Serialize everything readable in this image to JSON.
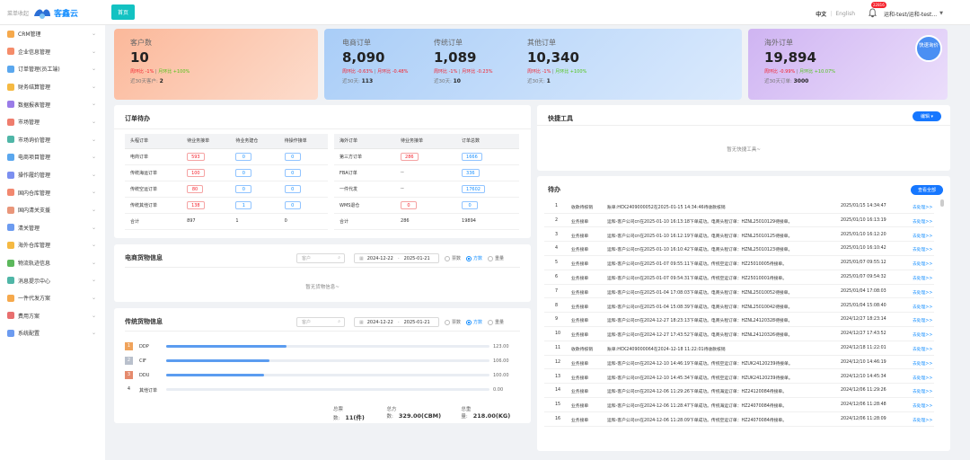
{
  "header": {
    "menu_label": "菜单收起",
    "brand": "客鑫云",
    "home_tab": "首页",
    "lang_zh": "中文",
    "lang_sep": "|",
    "lang_en": "English",
    "badge": "22816",
    "user": "运和-test/运和-test..."
  },
  "sidebar": {
    "items": [
      {
        "label": "CRM管理",
        "color": "#f6a94c"
      },
      {
        "label": "企业信息管理",
        "color": "#f58c6a"
      },
      {
        "label": "订单管理(员工端)",
        "color": "#5aa7ee"
      },
      {
        "label": "财务结算管理",
        "color": "#f5b942"
      },
      {
        "label": "数据报表管理",
        "color": "#9a7ce8"
      },
      {
        "label": "市场管理",
        "color": "#ef7d6d"
      },
      {
        "label": "市场询价管理",
        "color": "#4fb6a7"
      },
      {
        "label": "电商项目管理",
        "color": "#5aa7ee"
      },
      {
        "label": "操作履约管理",
        "color": "#7b8ff0"
      },
      {
        "label": "国内仓库管理",
        "color": "#f2886f"
      },
      {
        "label": "国内清关支援",
        "color": "#e9967a"
      },
      {
        "label": "清关管理",
        "color": "#6c9bf0"
      },
      {
        "label": "海外仓库管理",
        "color": "#f5b942"
      },
      {
        "label": "物流轨迹信息",
        "color": "#5cb85c"
      },
      {
        "label": "消息提示中心",
        "color": "#4fb6a7"
      },
      {
        "label": "一件代发方案",
        "color": "#f6a94c"
      },
      {
        "label": "费用方案",
        "color": "#e86f6f"
      },
      {
        "label": "系统配置",
        "color": "#6c9bf0"
      }
    ]
  },
  "cards": {
    "customers": {
      "title": "客户数",
      "value": "10",
      "cmp_a": "周环比 -1%",
      "cmp_sep": "|",
      "cmp_b": "月环比 +100%",
      "last_label": "近30天客户:",
      "last_value": "2"
    },
    "ecom": {
      "title": "电商订单",
      "value": "8,090",
      "cmp_a": "周环比 -0.63%",
      "cmp_sep": "|",
      "cmp_b": "月环比 -0.48%",
      "last_label": "近30天:",
      "last_value": "113"
    },
    "trad": {
      "title": "传统订单",
      "value": "1,089",
      "cmp_a": "周环比 -1%",
      "cmp_sep": "|",
      "cmp_b": "月环比 -0.23%",
      "last_label": "近30天:",
      "last_value": "10"
    },
    "other": {
      "title": "其他订单",
      "value": "10,340",
      "cmp_a": "周环比 -1%",
      "cmp_sep": "|",
      "cmp_b": "月环比 +100%",
      "last_label": "近30天:",
      "last_value": "1"
    },
    "overseas": {
      "title": "海外订单",
      "value": "19,894",
      "cmp_a": "周环比 -0.99%",
      "cmp_sep": "|",
      "cmp_b": "月环比 +10.07%",
      "last_label": "近30天订单:",
      "last_value": "3000"
    },
    "quick": "快速询价"
  },
  "pending": {
    "title": "订单待办",
    "left_headers": [
      "头程订单",
      "待业务接单",
      "待业务建仓",
      "待操作接单"
    ],
    "left_rows": [
      [
        "电商订单",
        "593",
        "0",
        "0"
      ],
      [
        "传统海运订单",
        "100",
        "0",
        "0"
      ],
      [
        "传统空运订单",
        "80",
        "0",
        "0"
      ],
      [
        "传统其他订单",
        "138",
        "1",
        "0"
      ],
      [
        "合计",
        "897",
        "1",
        "0"
      ]
    ],
    "right_headers": [
      "海外订单",
      "待业务接单",
      "订单总数"
    ],
    "right_rows": [
      [
        "第三方订单",
        "286",
        "1666"
      ],
      [
        "FBA订单",
        "--",
        "336"
      ],
      [
        "一件代发",
        "--",
        "17602"
      ],
      [
        "WMS退仓",
        "0",
        "0"
      ],
      [
        "合计",
        "286",
        "19894"
      ]
    ]
  },
  "ecom_goods": {
    "title": "电商货物信息",
    "customer_ph": "客户",
    "date_from": "2024-12-22",
    "date_to": "2025-01-21",
    "r1": "票数",
    "r2": "方数",
    "r3": "重量",
    "empty": "暂无货物信息~"
  },
  "trad_goods": {
    "title": "传统货物信息",
    "customer_ph": "客户",
    "date_from": "2024-12-22",
    "date_to": "2025-01-21",
    "r1": "票数",
    "r2": "方数",
    "r3": "重量",
    "rows": [
      {
        "rank": "1",
        "name": "DDP",
        "value": "123.00",
        "pct": 0.372
      },
      {
        "rank": "2",
        "name": "CIF",
        "value": "106.00",
        "pct": 0.32
      },
      {
        "rank": "3",
        "name": "DDU",
        "value": "100.00",
        "pct": 0.302
      },
      {
        "rank": "4",
        "name": "其他订单",
        "value": "0.00",
        "pct": 0
      }
    ],
    "totals": [
      {
        "label": "总票数:",
        "value": "11(件)"
      },
      {
        "label": "总方数:",
        "value": "329.00(CBM)"
      },
      {
        "label": "总重量:",
        "value": "218.00(KG)"
      }
    ]
  },
  "quick_tools": {
    "title": "快捷工具",
    "edit": "编辑 ▾",
    "empty": "暂无快捷工具~"
  },
  "todo": {
    "title": "待办",
    "view_all": "查看全部",
    "action": "去处理>>",
    "rows": [
      [
        "1",
        "收款待核销",
        "账单:HCK2409000052在2025-01-15 14:34:46待收款核销",
        "2025/01/15 14:34:47"
      ],
      [
        "2",
        "业务接单",
        "运和-客户公司cn在2025-01-10 16:13:18下单成功。电商头程订单：HZNL25010129待接单。",
        "2025/01/10 16:13:19"
      ],
      [
        "3",
        "业务接单",
        "运和-客户公司cn在2025-01-10 16:12:19下单成功。电商头程订单：HZNL25010125待接单。",
        "2025/01/10 16:12:20"
      ],
      [
        "4",
        "业务接单",
        "运和-客户公司cn在2025-01-10 16:10:42下单成功。电商头程订单：HZNL25010123待接单。",
        "2025/01/10 16:10:42"
      ],
      [
        "5",
        "业务接单",
        "运和-客户公司cn在2025-01-07 09:55:11下单成功。传统空运订单：HZ25010005待接单。",
        "2025/01/07 09:55:12"
      ],
      [
        "6",
        "业务接单",
        "运和-客户公司cn在2025-01-07 09:54:31下单成功。传统空运订单：HZ25010001待接单。",
        "2025/01/07 09:54:32"
      ],
      [
        "7",
        "业务接单",
        "运和-客户公司cn在2025-01-04 17:08:03下单成功。电商头程订单：HZNL25010052待接单。",
        "2025/01/04 17:08:03"
      ],
      [
        "8",
        "业务接单",
        "运和-客户公司cn在2025-01-04 15:08:39下单成功。电商头程订单：HZNL25010042待接单。",
        "2025/01/04 15:08:40"
      ],
      [
        "9",
        "业务接单",
        "运和-客户公司cn在2024-12-27 18:23:13下单成功。电商头程订单：HZNL24120328待接单。",
        "2024/12/27 18:23:14"
      ],
      [
        "10",
        "业务接单",
        "运和-客户公司cn在2024-12-27 17:43:52下单成功。电商头程订单：HZNL24120326待接单。",
        "2024/12/27 17:43:52"
      ],
      [
        "11",
        "收款待核销",
        "账单:HCK2409000064在2024-12-18 11:22:01待收款核销",
        "2024/12/18 11:22:01"
      ],
      [
        "12",
        "业务接单",
        "运和-客户公司cn在2024-12-10 14:46:19下单成功。传统空运订单：HZUK24120239待接单。",
        "2024/12/10 14:46:19"
      ],
      [
        "13",
        "业务接单",
        "运和-客户公司cn在2024-12-10 14:45:34下单成功。传统空运订单：HZUK24120239待接单。",
        "2024/12/10 14:45:34"
      ],
      [
        "14",
        "业务接单",
        "运和-客户公司cn在2024-12-06 11:29:26下单成功。传统海运订单：HZ24120084待接单。",
        "2024/12/06 11:29:26"
      ],
      [
        "15",
        "业务接单",
        "运和-客户公司cn在2024-12-06 11:28:47下单成功。传统海运订单：HZ24070084待接单。",
        "2024/12/06 11:28:48"
      ],
      [
        "16",
        "业务接单",
        "运和-客户公司cn在2024-12-06 11:28:09下单成功。传统空运订单：HZ24070084待接单。",
        "2024/12/06 11:28:09"
      ]
    ]
  }
}
